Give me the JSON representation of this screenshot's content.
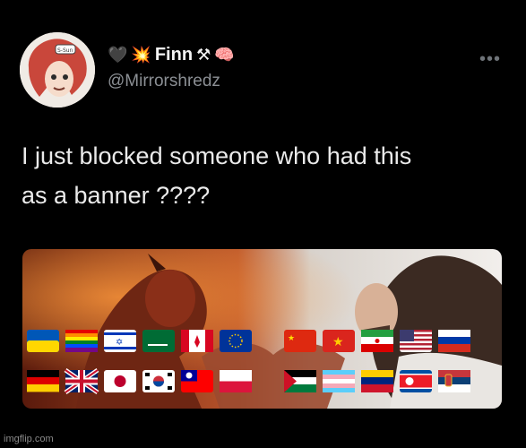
{
  "tweet": {
    "display_name": "Finn",
    "name_emojis": [
      "🖤",
      "💥",
      "⚒",
      "🧠"
    ],
    "handle": "@Mirrorshredz",
    "more_icon": "more-horizontal-icon",
    "text_line1": "I just blocked someone who had this",
    "text_line2": "as a banner ????",
    "avatar_text": "S-Sun"
  },
  "banner": {
    "description_icon": "banner-image",
    "left_flags_row1": [
      "Ukraine",
      "Pride",
      "Israel",
      "Saudi Arabia",
      "Canada",
      "European Union"
    ],
    "left_flags_row2": [
      "Germany",
      "United Kingdom",
      "Japan",
      "South Korea",
      "Taiwan",
      "Poland"
    ],
    "right_flags_row1": [
      "China",
      "Vietnam",
      "Iran",
      "United States",
      "Russia"
    ],
    "right_flags_row2": [
      "Palestine",
      "Transgender",
      "Venezuela",
      "North Korea",
      "Serbia"
    ]
  },
  "footer": {
    "watermark": "imgflip.com"
  }
}
